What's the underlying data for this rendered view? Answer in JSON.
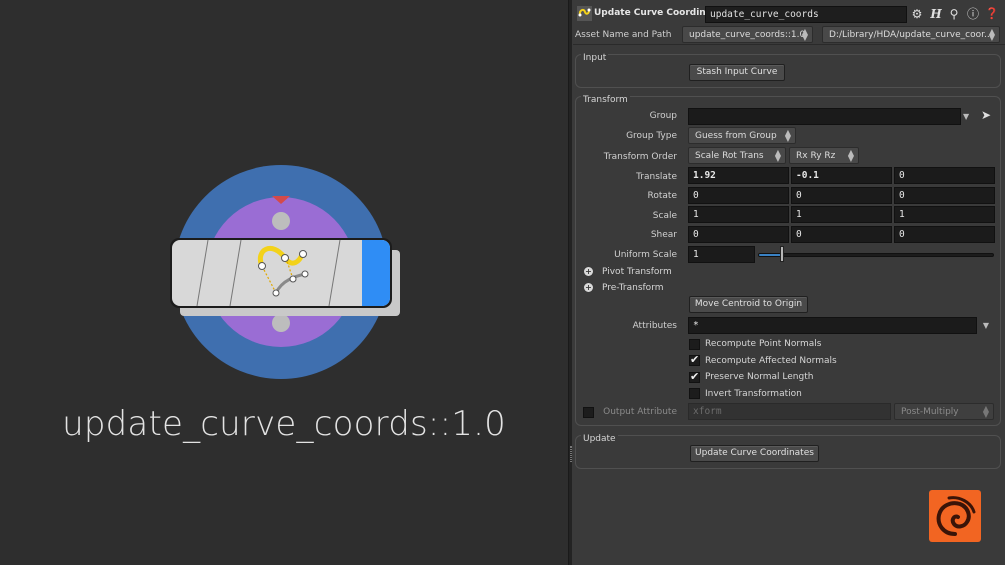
{
  "network": {
    "node_label": "update_curve_coords::1.0"
  },
  "header": {
    "node_type": "Update Curve Coordinates",
    "node_name": "update_curve_coords",
    "icons": [
      "gear-icon",
      "help-h-icon",
      "search-icon",
      "info-icon",
      "question-icon"
    ]
  },
  "asset": {
    "label": "Asset Name and Path",
    "name": "update_curve_coords::1.0",
    "path": "D:/Library/HDA/update_curve_coor..."
  },
  "input_folder": {
    "title": "Input",
    "stash_button": "Stash Input Curve"
  },
  "transform_folder": {
    "title": "Transform",
    "group_label": "Group",
    "group_value": "",
    "group_type_label": "Group Type",
    "group_type_value": "Guess from Group",
    "order_label": "Transform Order",
    "order_value": "Scale Rot Trans",
    "rot_order_value": "Rx Ry Rz",
    "translate_label": "Translate",
    "translate": [
      "1.92",
      "-0.1",
      "0"
    ],
    "rotate_label": "Rotate",
    "rotate": [
      "0",
      "0",
      "0"
    ],
    "scale_label": "Scale",
    "scale": [
      "1",
      "1",
      "1"
    ],
    "shear_label": "Shear",
    "shear": [
      "0",
      "0",
      "0"
    ],
    "uniform_scale_label": "Uniform Scale",
    "uniform_scale": "1",
    "uniform_scale_slider_fraction": 0.1,
    "pivot_label": "Pivot Transform",
    "pretransform_label": "Pre-Transform",
    "centroid_button": "Move Centroid to Origin",
    "attributes_label": "Attributes",
    "attributes_value": "*",
    "toggles": [
      {
        "label": "Recompute Point Normals",
        "checked": false
      },
      {
        "label": "Recompute Affected Normals",
        "checked": true
      },
      {
        "label": "Preserve Normal Length",
        "checked": true
      },
      {
        "label": "Invert Transformation",
        "checked": false
      }
    ],
    "output_attr_label": "Output Attribute",
    "output_attr_value": "xform",
    "output_mode": "Post-Multiply"
  },
  "update_folder": {
    "title": "Update",
    "update_button": "Update Curve Coordinates"
  },
  "colors": {
    "accent_blue": "#2f8df5",
    "node_outer": "#3e6fb0",
    "node_inner": "#9b6fd6",
    "logo_orange": "#f26522"
  }
}
